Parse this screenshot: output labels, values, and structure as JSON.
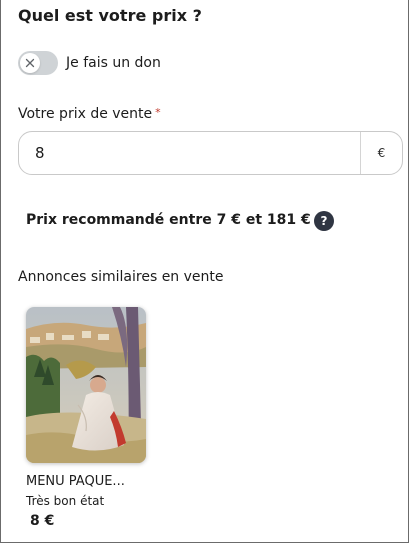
{
  "header": {
    "title": "Quel est votre prix ?"
  },
  "donation_toggle": {
    "label": "Je fais un don",
    "checked": false,
    "icon": "close-icon"
  },
  "price": {
    "label": "Votre prix de vente",
    "required_mark": "*",
    "value": "8",
    "currency": "€"
  },
  "recommendation": {
    "text": "Prix recommandé entre 7 € et 181 €",
    "help_icon": "?"
  },
  "similar": {
    "title": "Annonces similaires en vente",
    "items": [
      {
        "title": "MENU PAQUE...",
        "condition": "Très bon état",
        "price": "8 €",
        "image": "painting-thumbnail"
      }
    ]
  }
}
